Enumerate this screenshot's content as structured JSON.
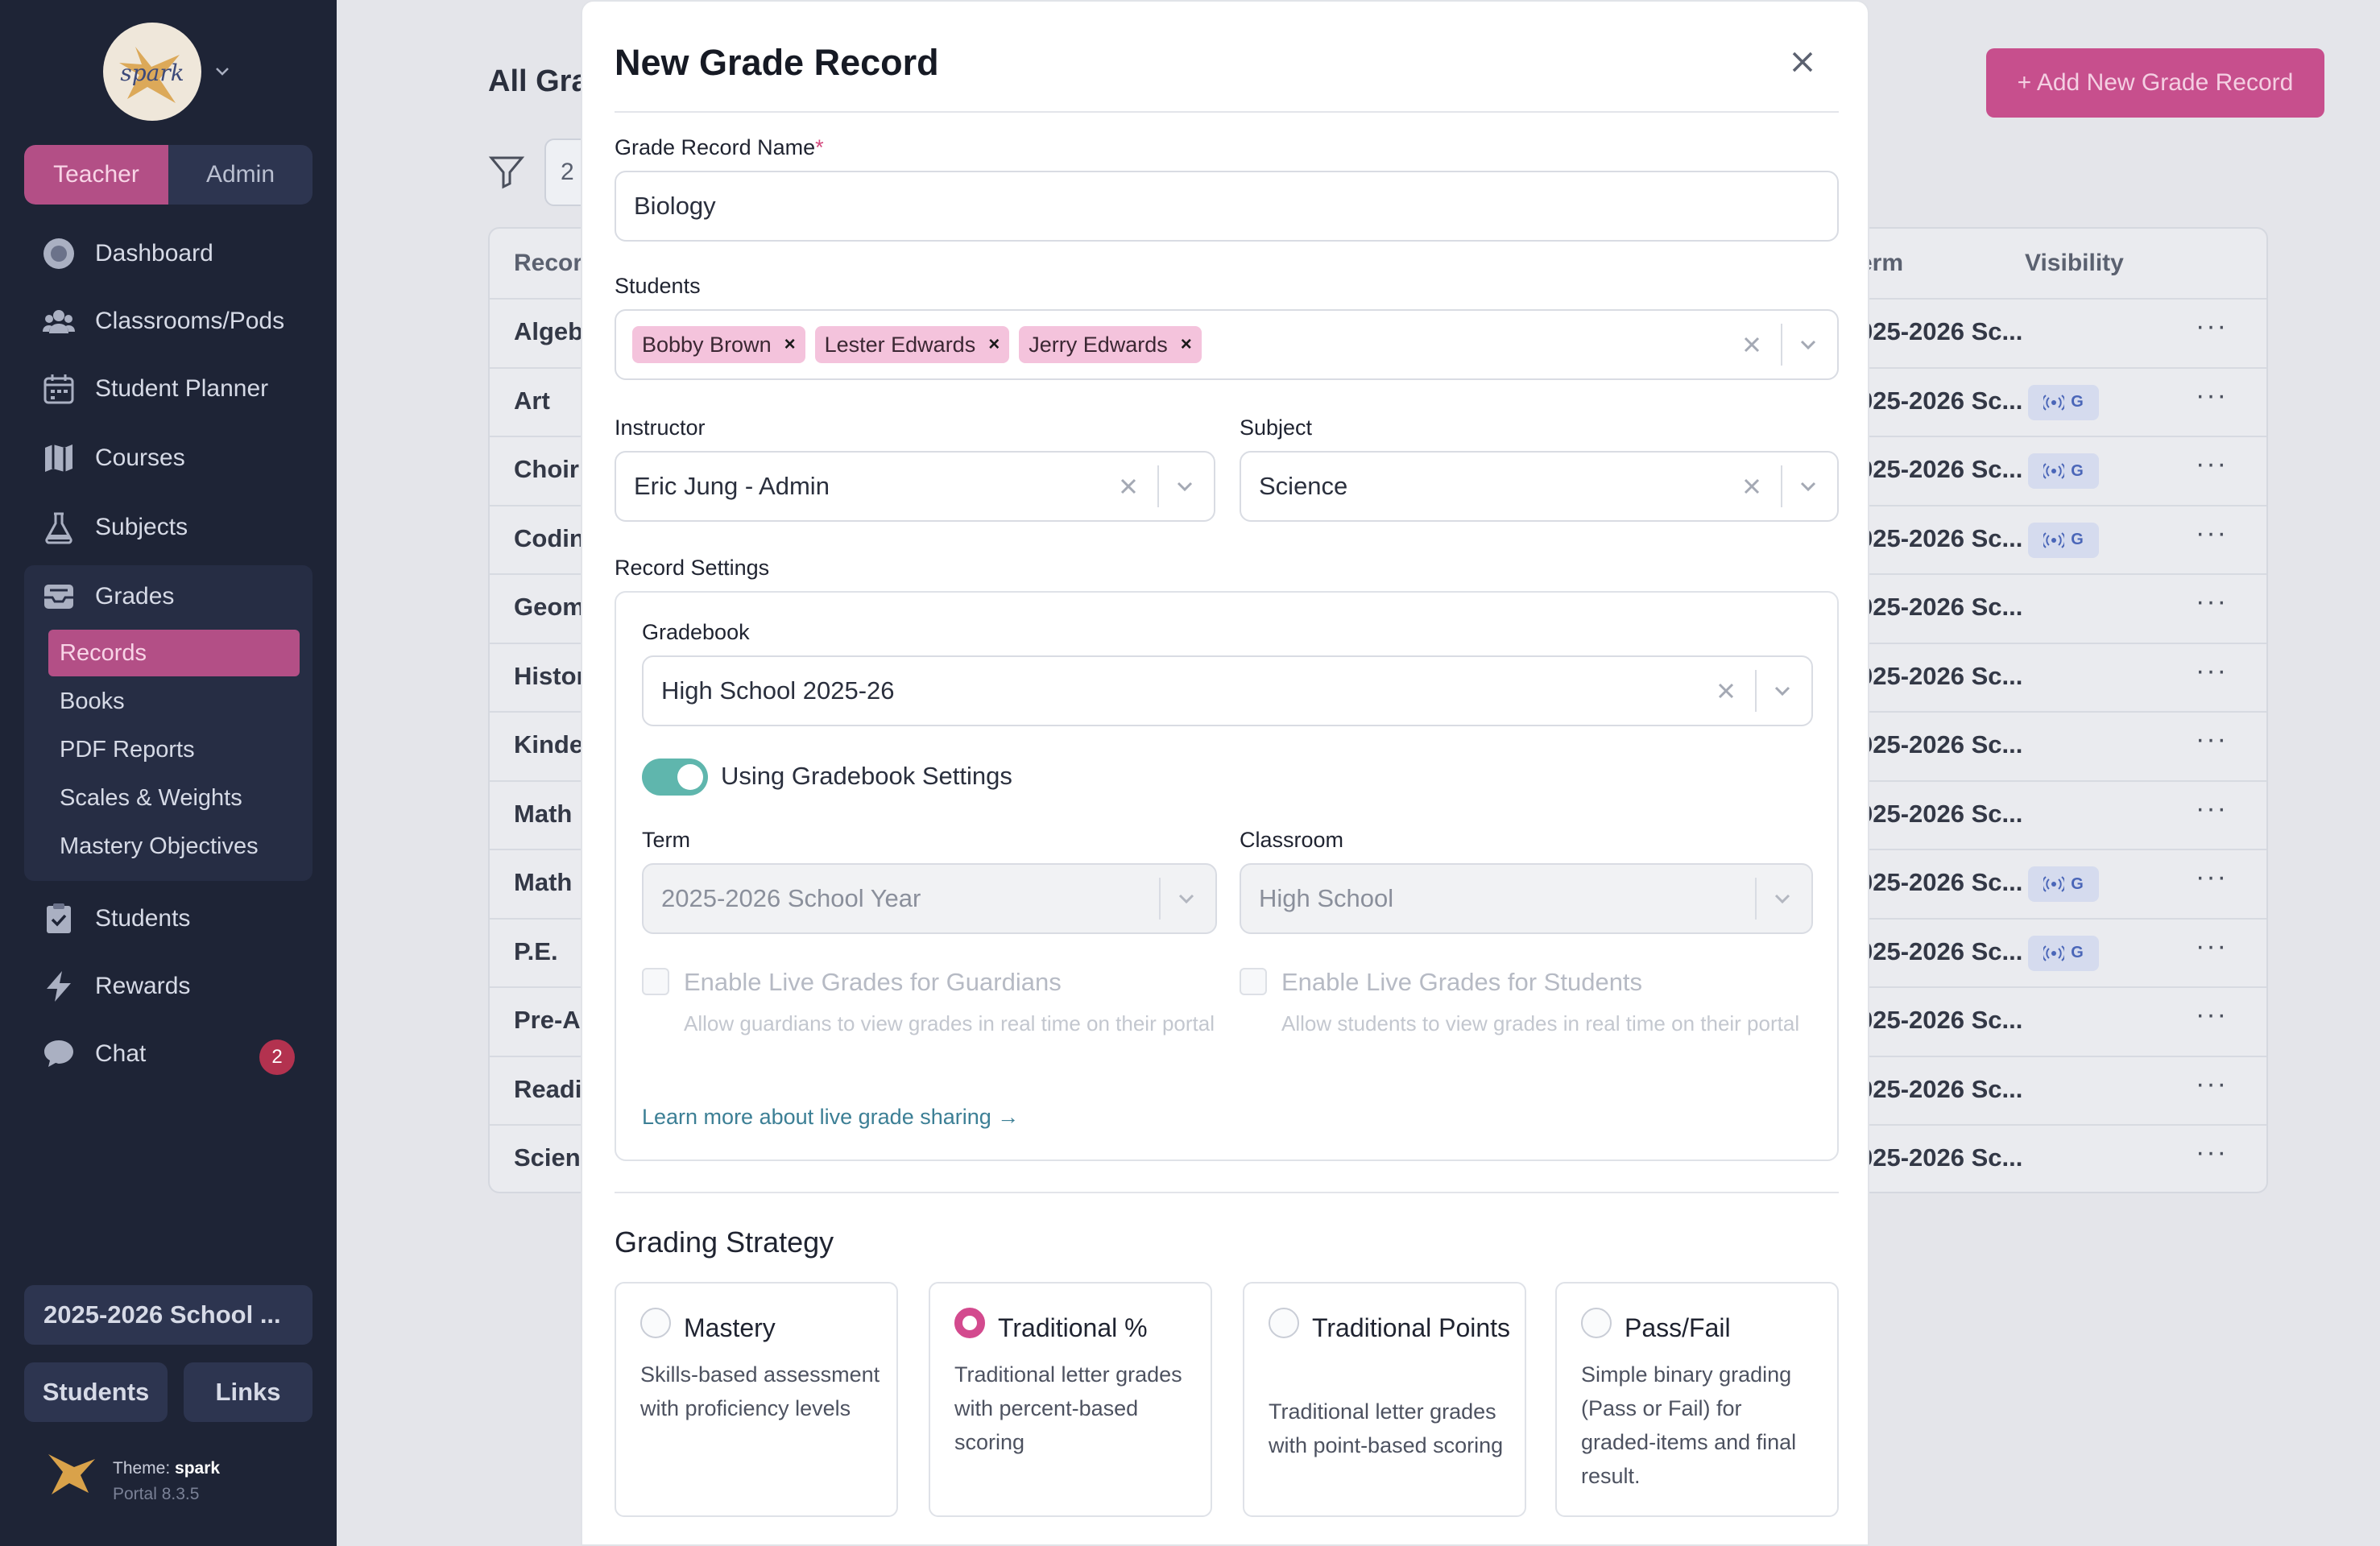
{
  "sidebar": {
    "logo_text": "spark",
    "roles": [
      "Teacher",
      "Admin"
    ],
    "nav": {
      "dashboard": "Dashboard",
      "classrooms": "Classrooms/Pods",
      "planner": "Student Planner",
      "courses": "Courses",
      "subjects": "Subjects",
      "grades": "Grades",
      "students": "Students",
      "rewards": "Rewards",
      "chat": "Chat",
      "chat_badge": "2"
    },
    "grades_sub": [
      "Records",
      "Books",
      "PDF Reports",
      "Scales & Weights",
      "Mastery Objectives"
    ],
    "term_button": "2025-2026 School ...",
    "footer_buttons": [
      "Students",
      "Links"
    ],
    "theme_label": "Theme:",
    "theme_name": "spark",
    "version": "Portal 8.3.5"
  },
  "background": {
    "title": "All Gra",
    "add_button": "+ Add New Grade Record",
    "filter_value": "2",
    "headers": {
      "record": "Recor",
      "term": "erm",
      "visibility": "Visibility"
    },
    "rows": [
      {
        "name": "Algeb",
        "term": "025-2026 Sc...",
        "vis": false
      },
      {
        "name": "Art",
        "term": "025-2026 Sc...",
        "vis": true
      },
      {
        "name": "Choir",
        "term": "025-2026 Sc...",
        "vis": true
      },
      {
        "name": "Codin",
        "term": "025-2026 Sc...",
        "vis": true
      },
      {
        "name": "Geom",
        "term": "025-2026 Sc...",
        "vis": false
      },
      {
        "name": "Histor",
        "term": "025-2026 Sc...",
        "vis": false
      },
      {
        "name": "Kinde",
        "term": "025-2026 Sc...",
        "vis": false
      },
      {
        "name": "Math",
        "term": "025-2026 Sc...",
        "vis": false
      },
      {
        "name": "Math",
        "term": "025-2026 Sc...",
        "vis": true
      },
      {
        "name": "P.E.",
        "term": "025-2026 Sc...",
        "vis": true
      },
      {
        "name": "Pre-A",
        "term": "025-2026 Sc...",
        "vis": false
      },
      {
        "name": "Readi",
        "term": "025-2026 Sc...",
        "vis": false
      },
      {
        "name": "Scien",
        "term": "025-2026 Sc...",
        "vis": false
      }
    ],
    "vis_badge_letter": "G",
    "row_menu": "···"
  },
  "modal": {
    "title": "New Grade Record",
    "name_label": "Grade Record Name",
    "required_mark": "*",
    "name_value": "Biology",
    "students_label": "Students",
    "students": [
      "Bobby Brown",
      "Lester Edwards",
      "Jerry Edwards"
    ],
    "chip_remove": "×",
    "instructor_label": "Instructor",
    "instructor_value": "Eric Jung - Admin",
    "subject_label": "Subject",
    "subject_value": "Science",
    "record_settings_label": "Record Settings",
    "gradebook_label": "Gradebook",
    "gradebook_value": "High School 2025-26",
    "toggle_label": "Using Gradebook Settings",
    "term_label": "Term",
    "term_value": "2025-2026 School Year",
    "classroom_label": "Classroom",
    "classroom_value": "High School",
    "live_guardians_label": "Enable Live Grades for Guardians",
    "live_guardians_desc": "Allow guardians to view grades in real time on their portal",
    "live_students_label": "Enable Live Grades for Students",
    "live_students_desc": "Allow students to view grades in real time on their portal",
    "learn_more": "Learn more about live grade sharing →",
    "grading_strategy_title": "Grading Strategy",
    "strategies": [
      {
        "title": "Mastery",
        "desc": "Skills-based assessment with proficiency levels",
        "selected": false
      },
      {
        "title": "Traditional %",
        "desc": "Traditional letter grades with percent-based scoring",
        "selected": true
      },
      {
        "title": "Traditional Points",
        "desc": "Traditional letter grades with point-based scoring",
        "selected": false
      },
      {
        "title": "Pass/Fail",
        "desc": "Simple binary grading (Pass or Fail) for graded-items and final result.",
        "selected": false
      }
    ]
  },
  "colors": {
    "sidebar_bg": "#1e2436",
    "accent_pink": "#b34f86",
    "toggle_teal": "#5fb6ad",
    "link_blue": "#3c7f95"
  }
}
